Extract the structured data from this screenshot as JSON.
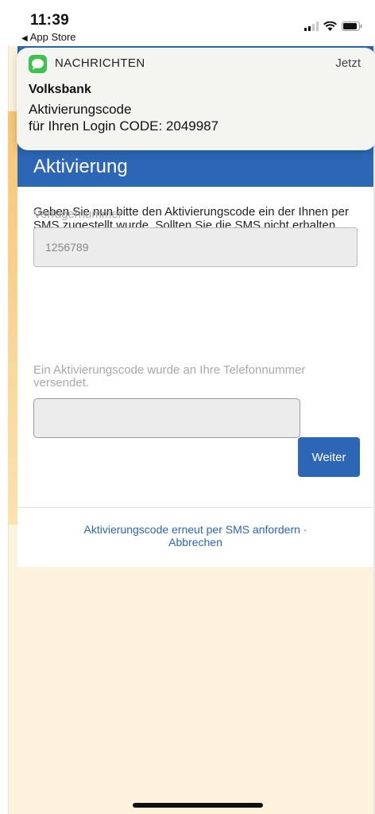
{
  "status_bar": {
    "time": "11:39",
    "back_label": "App Store"
  },
  "notification": {
    "app_name": "NACHRICHTEN",
    "time": "Jetzt",
    "sender": "Volksbank",
    "line1": "Aktivierungscode",
    "line2": "für Ihren Login CODE: 2049987"
  },
  "page": {
    "title": "Aktivierung",
    "intro": "Geben Sie nun bitte den Aktivierungscode ein der Ihnen per SMS zugestellt wurde. Sollten Sie die SMS nicht erhalten haben können sie unten in der Seite diese erneut anfordern.",
    "field1_label": "Verfügernummer",
    "field1_value": "1256789",
    "field2_label": "Ein Aktivierungscode wurde an Ihre Telefonnummer versendet.",
    "field2_value": "",
    "weiter_label": "Weiter",
    "resend_link": "Aktivierungscode erneut per SMS anfordern ·",
    "cancel_link": "Abbrechen"
  },
  "colors": {
    "brand_blue": "#2c66b4",
    "background": "#fdf3dc",
    "messages_green": "#3ec24f"
  },
  "icons": [
    "back-triangle-icon",
    "signal-icon",
    "wifi-icon",
    "battery-icon",
    "messages-app-icon"
  ]
}
